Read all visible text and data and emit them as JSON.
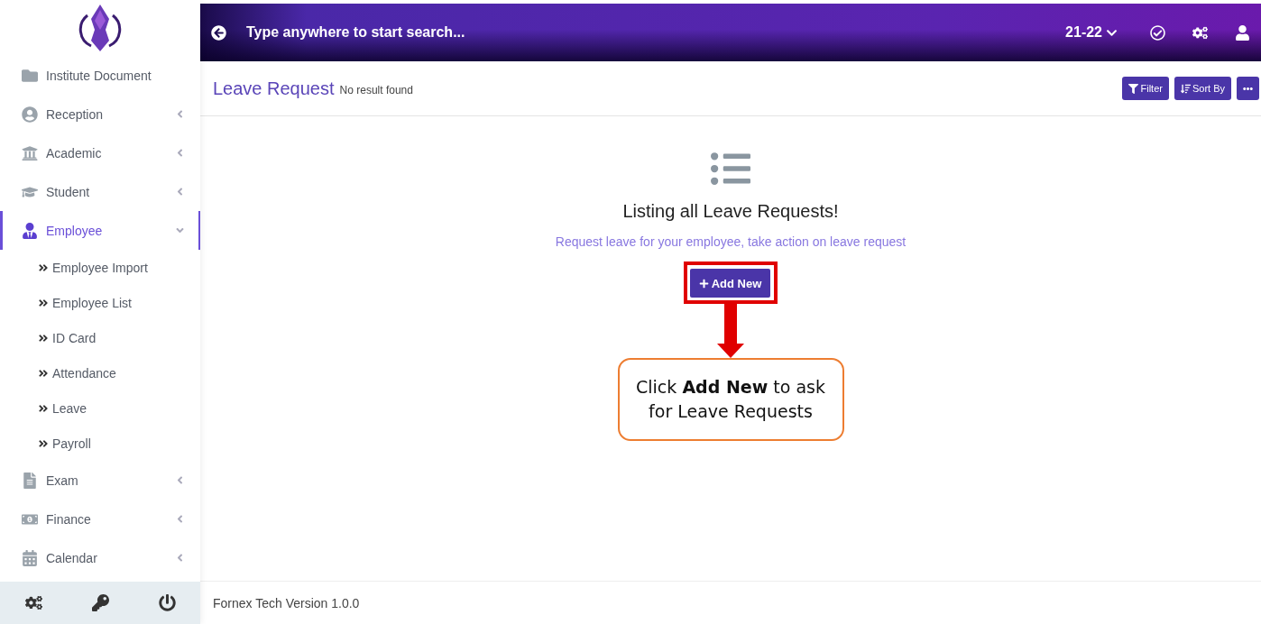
{
  "sidebar": {
    "items": [
      {
        "label": "Institute Document",
        "kind": "link",
        "selected": false
      },
      {
        "label": "Reception",
        "kind": "group",
        "selected": false,
        "expanded": false
      },
      {
        "label": "Academic",
        "kind": "group",
        "selected": false,
        "expanded": false
      },
      {
        "label": "Student",
        "kind": "group",
        "selected": false,
        "expanded": false
      },
      {
        "label": "Employee",
        "kind": "group",
        "selected": true,
        "expanded": true,
        "children": [
          {
            "label": "Employee Import"
          },
          {
            "label": "Employee List"
          },
          {
            "label": "ID Card"
          },
          {
            "label": "Attendance"
          },
          {
            "label": "Leave"
          },
          {
            "label": "Payroll"
          }
        ]
      },
      {
        "label": "Exam",
        "kind": "group",
        "selected": false,
        "expanded": false
      },
      {
        "label": "Finance",
        "kind": "group",
        "selected": false,
        "expanded": false
      },
      {
        "label": "Calendar",
        "kind": "group",
        "selected": false,
        "expanded": false
      }
    ]
  },
  "topbar": {
    "search": {
      "placeholder": "Type anywhere to start search..."
    },
    "session": "21-22"
  },
  "page_header": {
    "title": "Leave Request",
    "status": "No result found",
    "buttons": [
      {
        "kind": "filter",
        "label": "Filter"
      },
      {
        "kind": "sort",
        "label": "Sort By"
      },
      {
        "kind": "more"
      }
    ]
  },
  "empty_state": {
    "heading": "Listing all Leave Requests!",
    "description": "Request leave for your employee, take action on leave request",
    "add_button": "Add New"
  },
  "annotation": {
    "text": "Click **Add New** to ask for Leave Requests"
  },
  "footer": {
    "version": "Fornex Tech Version 1.0.0"
  }
}
